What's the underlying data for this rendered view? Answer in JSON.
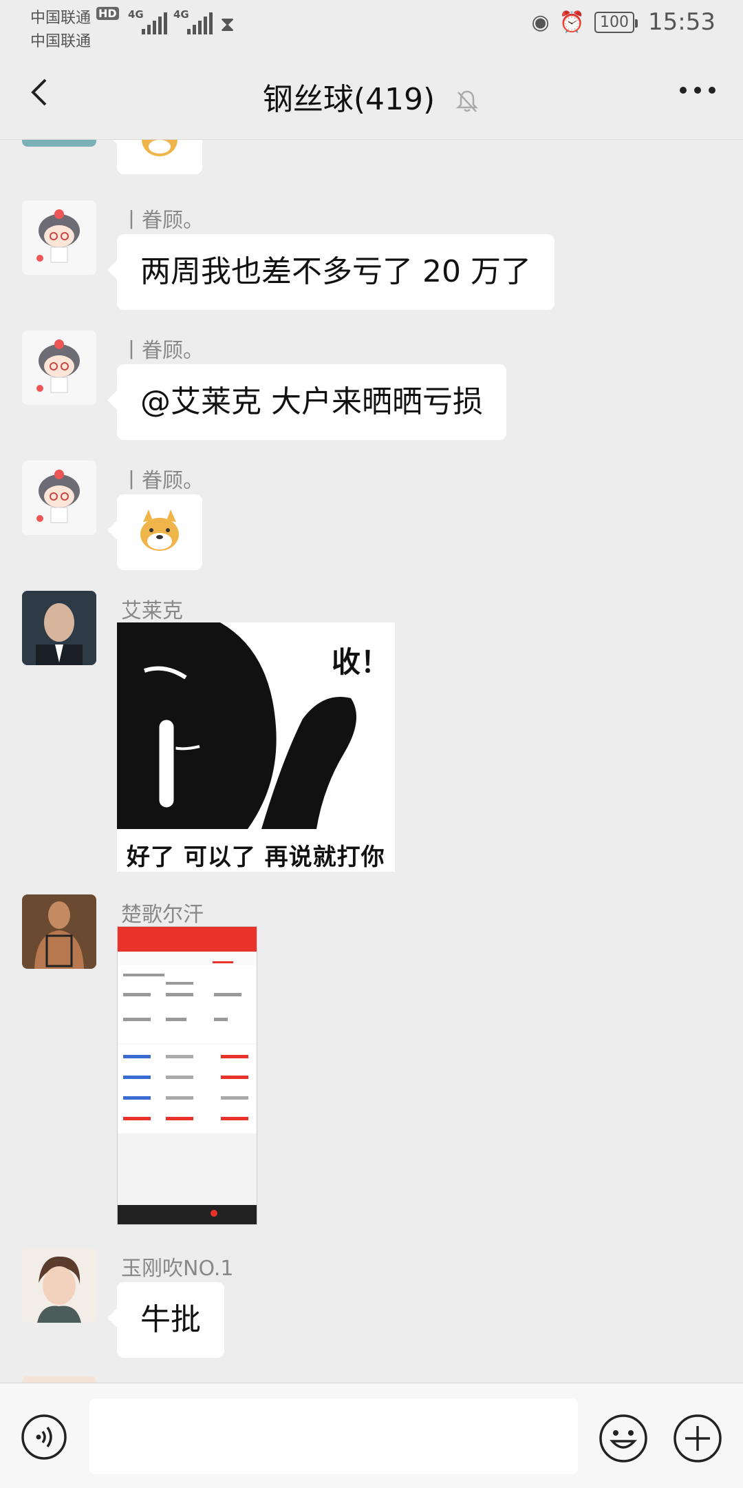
{
  "status_bar": {
    "carrier_1": "中国联通",
    "carrier_2": "中国联通",
    "hd_badge": "HD",
    "network_1": "4G",
    "network_2": "4G",
    "battery": "100",
    "time": "15:53"
  },
  "header": {
    "title": "钢丝球(419)"
  },
  "messages": [
    {
      "sender": "丨眷顾。",
      "text": "两周我也差不多亏了 20 万了"
    },
    {
      "sender": "丨眷顾。",
      "text": "@艾莱克 大户来晒晒亏损"
    },
    {
      "sender": "丨眷顾。",
      "sticker": "doge-emoji"
    },
    {
      "sender": "艾莱克",
      "image_caption_top": "收！",
      "image_caption_bottom": "好了 可以了 再说就打你"
    },
    {
      "sender": "楚歌尔汗",
      "image": "trading-app-screenshot"
    },
    {
      "sender": "玉刚吹NO.1",
      "text": "牛批"
    }
  ],
  "input_bar": {
    "placeholder": ""
  },
  "colors": {
    "background": "#ededed",
    "bubble": "#ffffff",
    "app_red": "#e8322a"
  }
}
